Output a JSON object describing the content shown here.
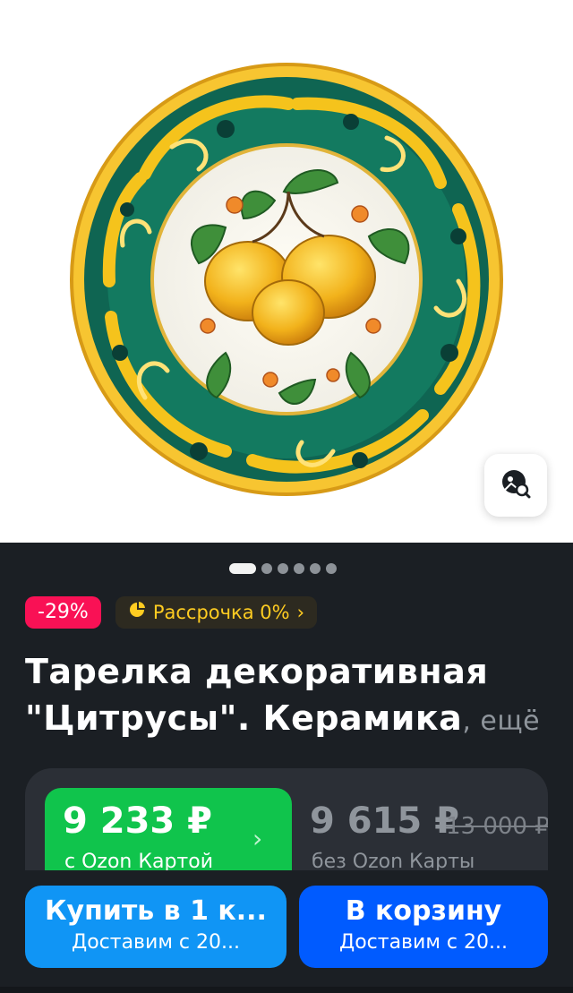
{
  "product": {
    "image_alt": "Декоративная тарелка с лимонами",
    "discount": "-29%",
    "installment": "Рассрочка 0%",
    "title": "Тарелка декоративная \"Цитрусы\". Керамика",
    "title_more": ", ещё"
  },
  "gallery": {
    "total_dots": 6,
    "active_index": 0
  },
  "prices": {
    "ozon_card_price": "9 233 ₽",
    "ozon_card_label": "с Ozon Картой",
    "regular_price": "9 615 ₽",
    "old_price": "13 000 ₽",
    "regular_label": "без Ozon Карты"
  },
  "actions": {
    "buy_label": "Купить в 1 к...",
    "buy_sub": "Доставим с 20...",
    "cart_label": "В корзину",
    "cart_sub": "Доставим с 20..."
  },
  "colors": {
    "discount": "#f91155",
    "installment_text": "#ffcc21",
    "ozon_green": "#10c44c",
    "buy_button": "#1095f5",
    "cart_button": "#005bff"
  },
  "icons": [
    "image-search-icon",
    "installment-icon",
    "chevron-right-icon"
  ]
}
